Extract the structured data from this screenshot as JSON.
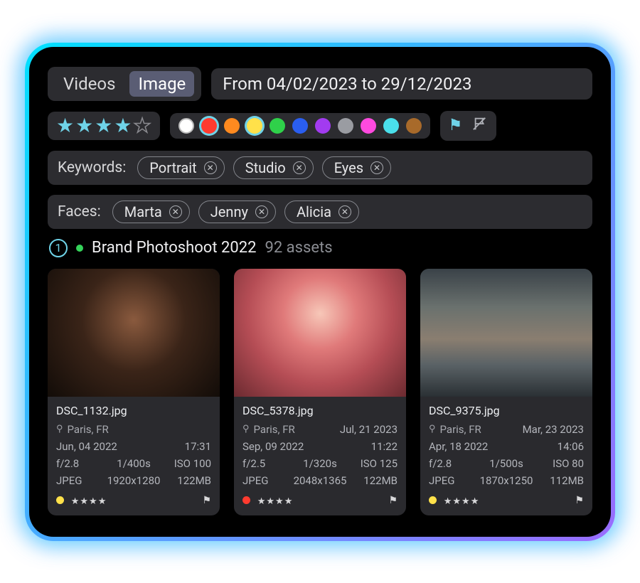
{
  "tabs": {
    "videos": "Videos",
    "image": "Image",
    "active": "image"
  },
  "date_range": "From 04/02/2023 to 29/12/2023",
  "rating_filter": {
    "value": 4,
    "max": 5
  },
  "color_swatches": [
    {
      "hex": "#ffffff",
      "selected": false
    },
    {
      "hex": "#ff3b2f",
      "selected": true
    },
    {
      "hex": "#ff8a1f",
      "selected": false
    },
    {
      "hex": "#ffe14a",
      "selected": true
    },
    {
      "hex": "#2fd14a",
      "selected": false
    },
    {
      "hex": "#2a5ef0",
      "selected": false
    },
    {
      "hex": "#a23bf0",
      "selected": false
    },
    {
      "hex": "#9a9ca2",
      "selected": false
    },
    {
      "hex": "#ff4adf",
      "selected": false
    },
    {
      "hex": "#4adfea",
      "selected": false
    },
    {
      "hex": "#a86a2a",
      "selected": false
    }
  ],
  "keywords_label": "Keywords:",
  "keywords": [
    "Portrait",
    "Studio",
    "Eyes"
  ],
  "faces_label": "Faces:",
  "faces": [
    "Marta",
    "Jenny",
    "Alicia"
  ],
  "collection": {
    "index": "1",
    "name": "Brand Photoshoot 2022",
    "count": "92 assets"
  },
  "cards": [
    {
      "filename": "DSC_1132.jpg",
      "location": "Paris, FR",
      "shoot_date": "",
      "capture_date": "Jun, 04 2022",
      "capture_time": "17:31",
      "aperture": "f/2.8",
      "shutter": "1/400s",
      "iso": "ISO 100",
      "format": "JPEG",
      "dimensions": "1920x1280",
      "size": "122MB",
      "color_dot": "#ffe14a",
      "stars": "★★★★"
    },
    {
      "filename": "DSC_5378.jpg",
      "location": "Paris, FR",
      "shoot_date": "Jul, 21 2023",
      "capture_date": "Sep, 09 2022",
      "capture_time": "11:22",
      "aperture": "f/2.5",
      "shutter": "1/320s",
      "iso": "ISO 125",
      "format": "JPEG",
      "dimensions": "2048x1365",
      "size": "122MB",
      "color_dot": "#ff3b2f",
      "stars": "★★★★"
    },
    {
      "filename": "DSC_9375.jpg",
      "location": "Paris, FR",
      "shoot_date": "Mar, 23 2023",
      "capture_date": "Apr, 18 2022",
      "capture_time": "14:06",
      "aperture": "f/2.8",
      "shutter": "1/500s",
      "iso": "ISO 80",
      "format": "JPEG",
      "dimensions": "1870x1250",
      "size": "112MB",
      "color_dot": "#ffe14a",
      "stars": "★★★★"
    }
  ]
}
